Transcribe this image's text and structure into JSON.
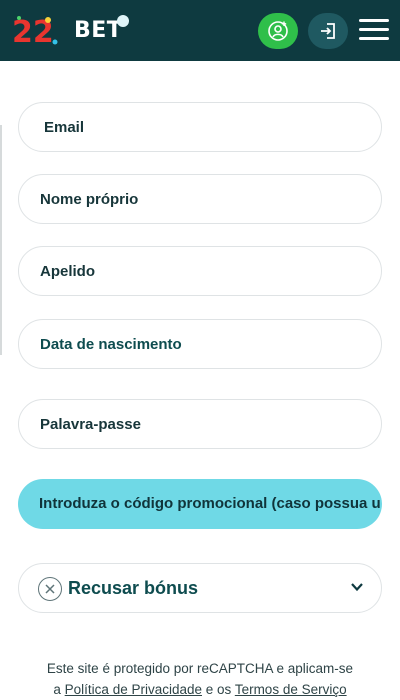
{
  "header": {
    "logo_text": "BET",
    "logo_number": "22",
    "colors": {
      "background": "#0e3a40",
      "profile_button": "#2fbf4a",
      "login_button": "#1f5961"
    },
    "icons": {
      "profile": "user-plus-icon",
      "login": "sign-in-icon",
      "menu": "hamburger-icon"
    }
  },
  "form": {
    "email_label": "Email",
    "first_name_label": "Nome próprio",
    "last_name_label": "Apelido",
    "dob_label": "Data de nascimento",
    "password_label": "Palavra-passe",
    "promo_label": "Introduza o código promocional (caso possua u",
    "bonus_label": "Recusar bónus",
    "colors": {
      "promo_background": "#6fd9e6",
      "accent_text": "#0e4c4f"
    },
    "icons": {
      "bonus_clear": "close-circle-icon",
      "bonus_dropdown": "chevron-down-icon"
    }
  },
  "legal": {
    "line1": "Este site é protegido por reCAPTCHA e aplicam-se",
    "prefix": "a",
    "privacy_link": "Política de Privacidade",
    "connector": "e os",
    "terms_link": "Termos de Serviço"
  }
}
